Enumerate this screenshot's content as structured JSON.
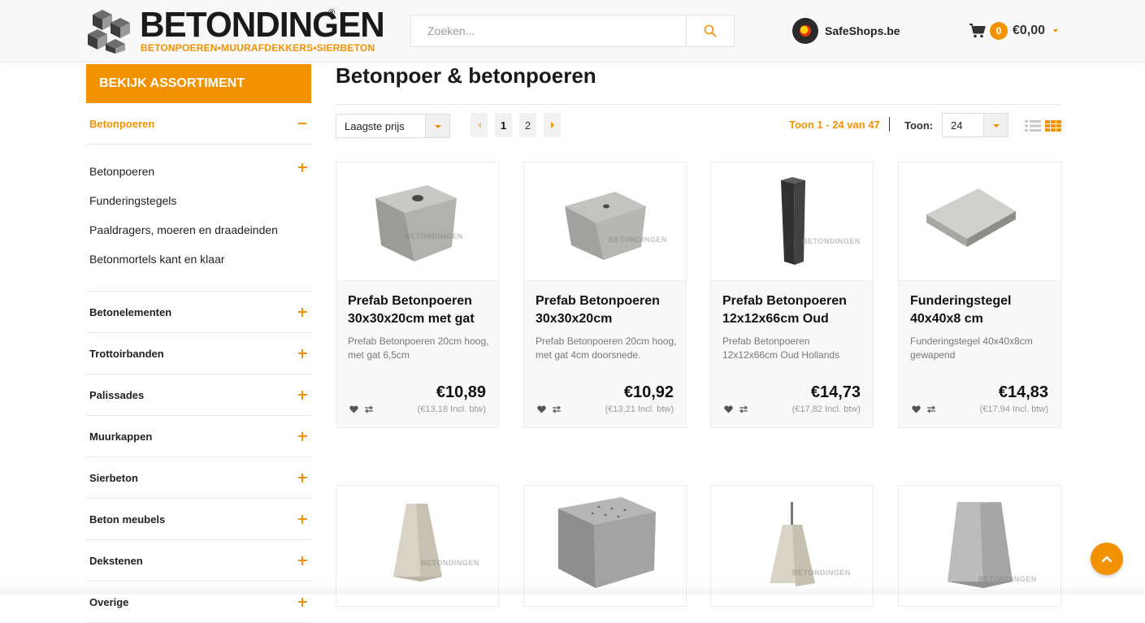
{
  "header": {
    "brand_name": "BETONDINGEN",
    "brand_reg": "®",
    "brand_tagline": "BETONPOEREN•MUURAFDEKKERS•SIERBETON",
    "search_placeholder": "Zoeken...",
    "safeshops_label": "SafeShops.be",
    "cart_count": "0",
    "cart_total": "€0,00",
    "accent_color": "#f39200"
  },
  "sidebar": {
    "assortment_button": "BEKIJK ASSORTIMENT",
    "active_category": "Betonpoeren",
    "subcategories": [
      "Betonpoeren",
      "Funderingstegels",
      "Paaldragers, moeren en draadeinden",
      "Betonmortels kant en klaar"
    ],
    "categories": [
      "Betonelementen",
      "Trottoirbanden",
      "Palissades",
      "Muurkappen",
      "Sierbeton",
      "Beton meubels",
      "Dekstenen",
      "Overige"
    ]
  },
  "main": {
    "title": "Betonpoer & betonpoeren",
    "sort_selected": "Laagste prijs",
    "pages": [
      "1",
      "2"
    ],
    "range_text": "Toon 1 - 24 van 47",
    "show_label": "Toon:",
    "per_page": "24"
  },
  "products": [
    {
      "name": "Prefab Betonpoeren 30x30x20cm met gat",
      "desc": "Prefab Betonpoeren 20cm hoog, met gat 6,5cm",
      "price": "€10,89",
      "vat": "(€13,18 Incl. btw)",
      "image": "cube-with-hole"
    },
    {
      "name": "Prefab Betonpoeren 30x30x20cm",
      "desc": "Prefab Betonpoeren 20cm hoog, met gat 4cm doorsnede.",
      "price": "€10,92",
      "vat": "(€13,21 Incl. btw)",
      "image": "cube-with-small-hole"
    },
    {
      "name": "Prefab Betonpoeren 12x12x66cm Oud",
      "desc": "Prefab Betonpoeren 12x12x66cm Oud Hollands",
      "price": "€14,73",
      "vat": "(€17,82 Incl. btw)",
      "image": "dark-post"
    },
    {
      "name": "Funderingstegel 40x40x8 cm",
      "desc": "Funderingstegel 40x40x8cm gewapend",
      "price": "€14,83",
      "vat": "(€17,94 Incl. btw)",
      "image": "flat-tile"
    }
  ],
  "watermark": "BETONDINGEN",
  "icons": {
    "search": "search-icon",
    "cart": "cart-icon",
    "heart": "heart-icon",
    "compare": "compare-icon",
    "back_to_top": "chevron-up-icon"
  }
}
